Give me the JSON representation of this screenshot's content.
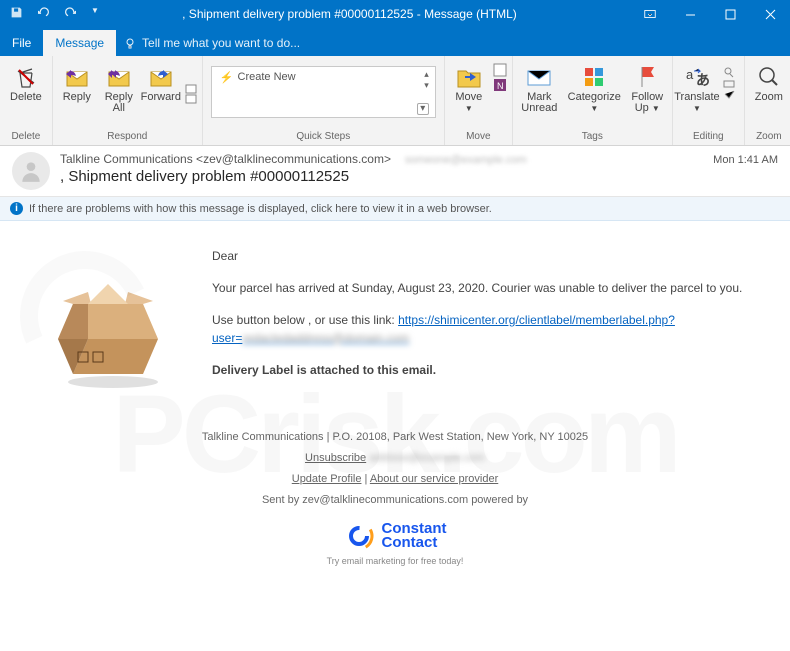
{
  "titlebar": {
    "title": ", Shipment delivery problem #00000112525 - Message (HTML)"
  },
  "tabs": {
    "file": "File",
    "message": "Message",
    "tell": "Tell me what you want to do..."
  },
  "ribbon": {
    "delete": "Delete",
    "reply": "Reply",
    "replyall": "Reply\nAll",
    "forward": "Forward",
    "qs_create": "Create New",
    "move": "Move",
    "mark": "Mark\nUnread",
    "categorize": "Categorize",
    "followup": "Follow\nUp",
    "translate": "Translate",
    "zoom": "Zoom",
    "grp_delete": "Delete",
    "grp_respond": "Respond",
    "grp_qs": "Quick Steps",
    "grp_move": "Move",
    "grp_tags": "Tags",
    "grp_edit": "Editing",
    "grp_zoom": "Zoom"
  },
  "header": {
    "from": "Talkline Communications <zev@talklinecommunications.com>",
    "subject": ", Shipment delivery problem #00000112525",
    "time": "Mon 1:41 AM",
    "recipients_blur": "someone@example.com"
  },
  "infobar": {
    "text": "If there are problems with how this message is displayed, click here to view it in a web browser."
  },
  "body": {
    "greeting": "Dear",
    "p1": "Your parcel has arrived at Sunday, August 23, 2020. Courier was unable to deliver the parcel to you.",
    "p2a": "Use button below , or use this link: ",
    "link": "https://shimicenter.org/clientlabel/memberlabel.php?user=",
    "p3": "Delivery Label is attached to this email."
  },
  "footer": {
    "addr": "Talkline Communications | P.O. 20108, Park West Station, New York, NY 10025",
    "unsub": "Unsubscribe",
    "unsub_blur": "address@example.com",
    "update": "Update Profile",
    "about": "About our service provider",
    "sent": "Sent by zev@talklinecommunications.com powered by",
    "brand": "Constant\nContact",
    "tag": "Try email marketing for free today!"
  }
}
